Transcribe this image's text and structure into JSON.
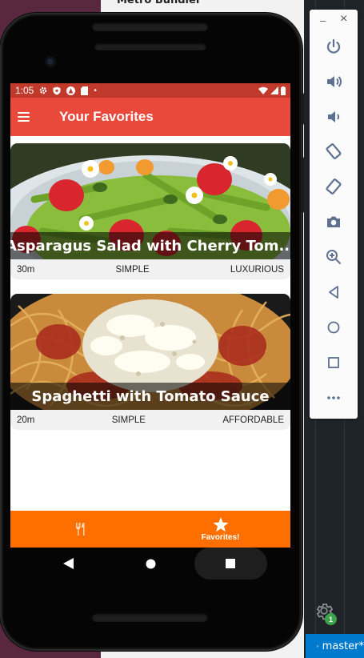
{
  "background_window": {
    "title": "Metro Bundler"
  },
  "vscode": {
    "branch": "master*",
    "notification_count": "1"
  },
  "emulator_toolbar": {
    "minimize_label": "–",
    "close_label": "×",
    "buttons": [
      "power-icon",
      "volume-up-icon",
      "volume-down-icon",
      "rotate-left-icon",
      "rotate-right-icon",
      "camera-icon",
      "zoom-icon",
      "back-icon",
      "home-icon",
      "overview-icon",
      "more-icon"
    ]
  },
  "status_bar": {
    "time": "1:05"
  },
  "app_bar": {
    "title": "Your Favorites"
  },
  "meals": [
    {
      "title": "Asparagus Salad with Cherry Tom...",
      "duration": "30m",
      "complexity": "SIMPLE",
      "affordability": "LUXURIOUS"
    },
    {
      "title": "Spaghetti with Tomato Sauce",
      "duration": "20m",
      "complexity": "SIMPLE",
      "affordability": "AFFORDABLE"
    }
  ],
  "bottom_tabs": [
    {
      "label": "",
      "icon": "utensils-icon",
      "active": false
    },
    {
      "label": "Favorites!",
      "icon": "star-icon",
      "active": true
    }
  ],
  "colors": {
    "app_bar": "#e8493a",
    "status_bar": "#c0392b",
    "tab_bar": "#ff6f00",
    "vscode_status": "#007acc"
  }
}
